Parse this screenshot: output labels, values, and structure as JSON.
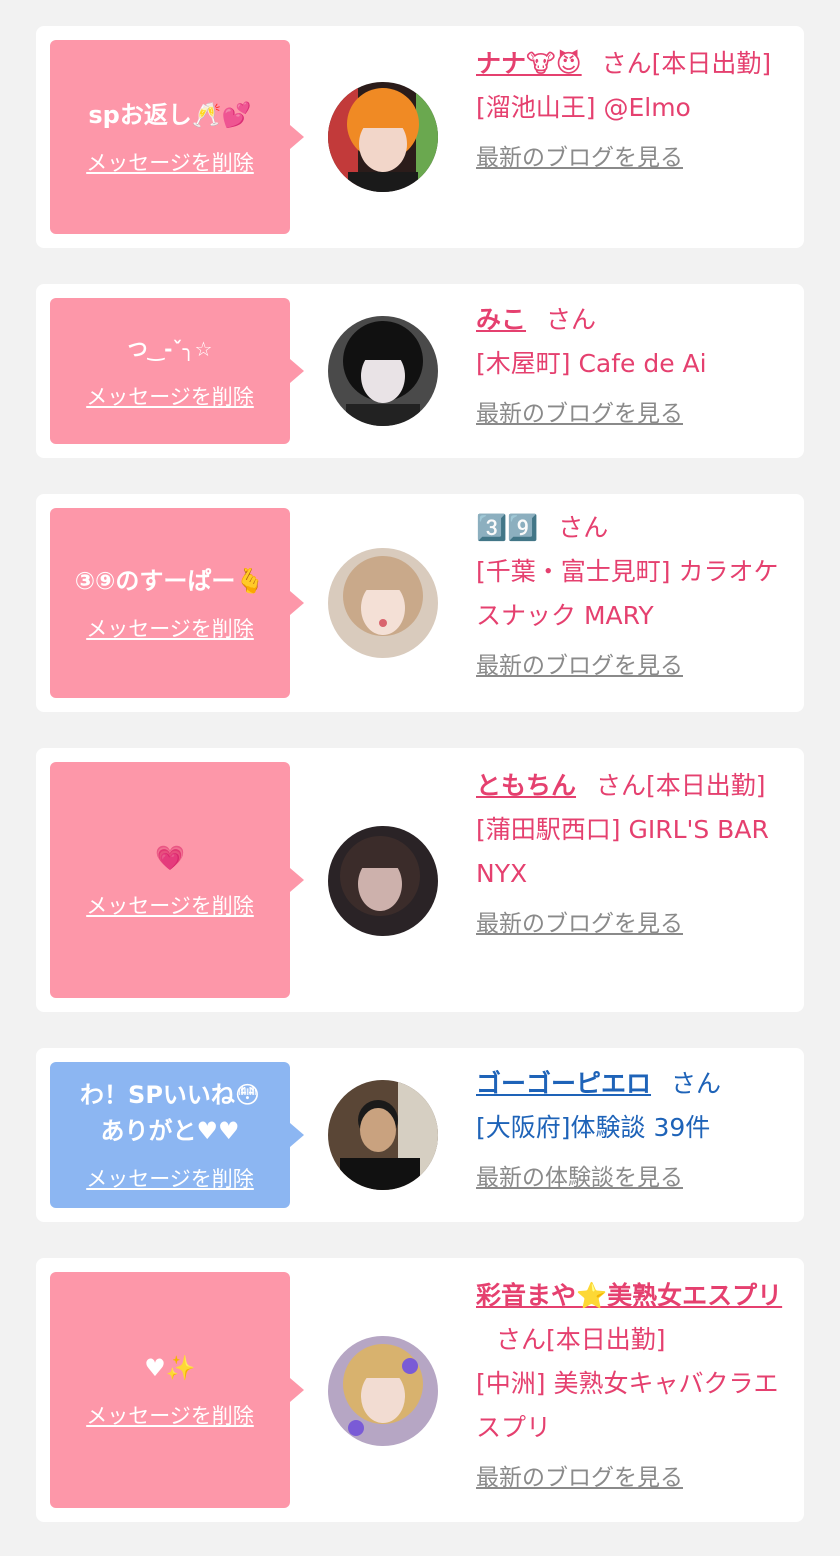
{
  "colors": {
    "accent_pink": "#e5406f",
    "bubble_pink": "#fd97a9",
    "bubble_blue": "#8cb6f2",
    "link_blue": "#1e63b8",
    "muted": "#8a8a8a"
  },
  "delete_label": "メッセージを削除",
  "blog_label": "最新のブログを見る",
  "review_label": "最新の体験談を見る",
  "san_label": "さん",
  "cards": [
    {
      "message": "spお返し🥂💕",
      "name": "ナナ🐮😈",
      "line1": "[本日出勤]",
      "line2": "[溜池山王] @Elmo"
    },
    {
      "message": "つ‿-ˇ╮☆",
      "name": "みこ",
      "line1": "",
      "line2": "[木屋町] Cafe de Ai"
    },
    {
      "message": "③⑨のすーぱー🫰",
      "name": "3️⃣9️⃣",
      "line1": "",
      "line2": "[千葉・富士見町] カラオケスナック MARY"
    },
    {
      "message": "💗",
      "name": "ともちん",
      "line1": "[本日出勤]",
      "line2": "[蒲田駅西口] GIRL'S BAR NYX"
    },
    {
      "message": "わ！SPいいね😳\nありがと♥♥",
      "name": "ゴーゴーピエロ",
      "line1": "",
      "line2": "[大阪府]体験談 39件"
    },
    {
      "message": "♥✨",
      "name": "彩音まや⭐美熟女エスプリ",
      "line1": "[本日出勤]",
      "line2": "[中洲] 美熟女キャバクラエスプリ"
    }
  ]
}
